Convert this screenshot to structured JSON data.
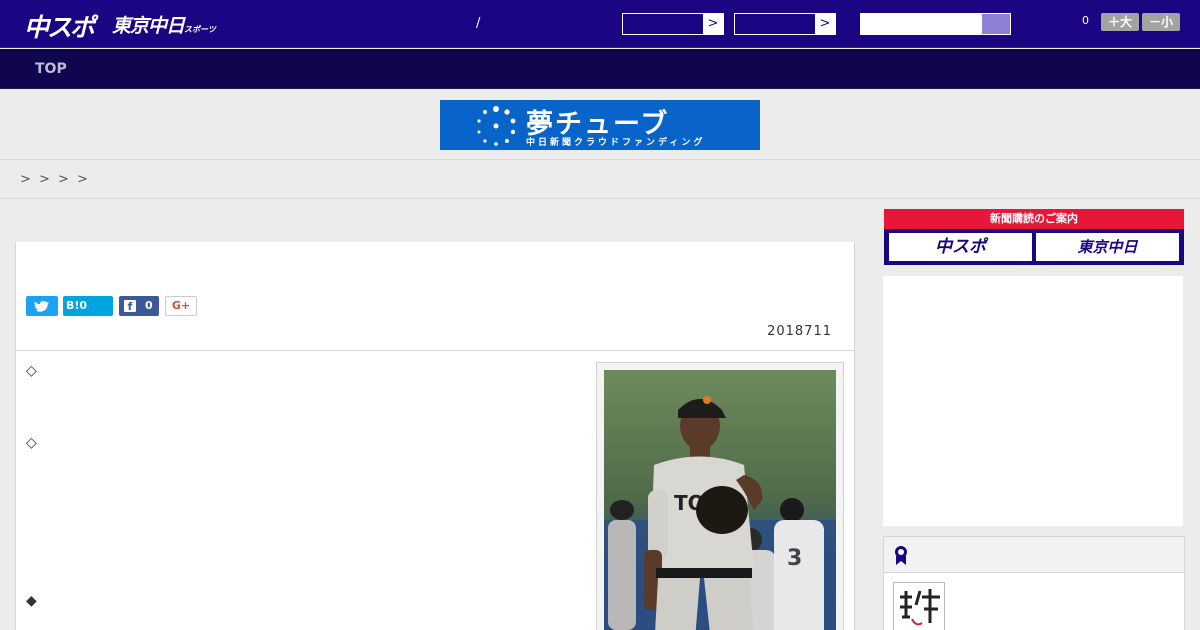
{
  "header": {
    "logo_main": "中スポ",
    "logo_sub": "東京中日",
    "logo_sub_small": "スポーツ",
    "separator": "/",
    "select_arrow": ">",
    "font_count": "0",
    "font_larger": "＋大",
    "font_smaller": "－小"
  },
  "nav": {
    "top": "TOP"
  },
  "banner": {
    "title": "夢チューブ",
    "subtitle": "中日新聞クラウドファンディング"
  },
  "breadcrumb": [
    ">",
    ">",
    ">",
    ">"
  ],
  "article": {
    "share": {
      "hatena": "B!0",
      "facebook_count": "0",
      "gplus": "G+"
    },
    "date": "2018711",
    "markers": [
      "◇",
      "◇",
      "◆"
    ]
  },
  "sidebar": {
    "subscribe_header": "新聞購読のご案内",
    "subscribe_left": "中スポ",
    "subscribe_right": "東京中日"
  },
  "colors": {
    "header": "#1b0583",
    "nav": "#10064f",
    "accent_red": "#e01832",
    "accent_purple": "#6e5dbd",
    "banner": "#0864c8"
  }
}
